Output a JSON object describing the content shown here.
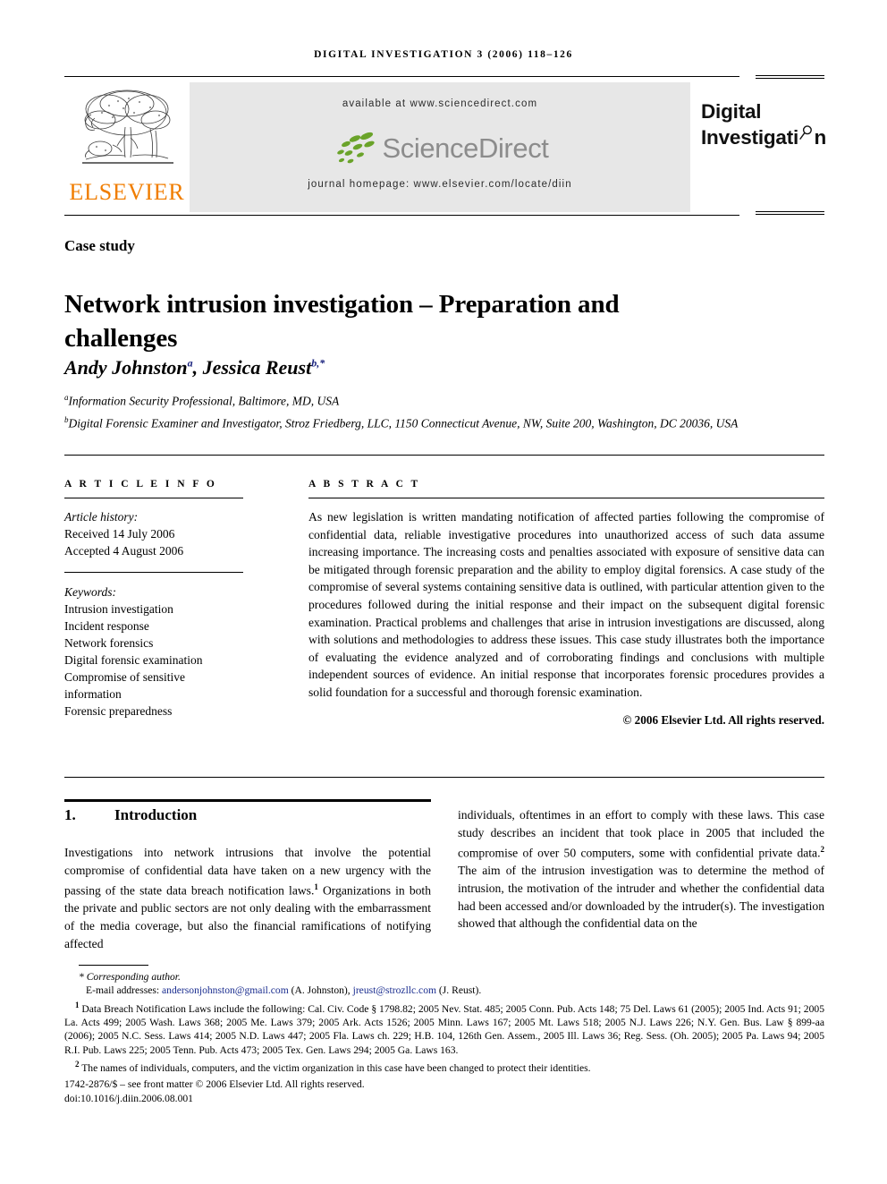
{
  "running_head": "DIGITAL INVESTIGATION 3 (2006) 118–126",
  "masthead": {
    "publisher_name": "ELSEVIER",
    "publisher_logo": "elsevier-tree-logo",
    "available_at": "available at www.sciencedirect.com",
    "sciencedirect_word": "ScienceDirect",
    "journal_homepage": "journal homepage: www.elsevier.com/locate/diin",
    "journal_logo_line1": "Digital",
    "journal_logo_line2a": "Investigati",
    "journal_logo_line2b": "n",
    "elsevier_orange": "#f07d00",
    "sciencedirect_green": "#6aa32a",
    "panel_gray": "#e7e7e7"
  },
  "article": {
    "kind": "Case study",
    "title": "Network intrusion investigation – Preparation and challenges",
    "authors_html": "Andy Johnston<sup>a</sup>, Jessica Reust<sup>b,*</sup>",
    "affiliations": [
      "<sup>a</sup>Information Security Professional, Baltimore, MD, USA",
      "<sup>b</sup>Digital Forensic Examiner and Investigator, Stroz Friedberg, LLC, 1150 Connecticut Avenue, NW, Suite 200, Washington, DC 20036, USA"
    ]
  },
  "article_info": {
    "heading": "A R T I C L E  I N F O",
    "history_label": "Article history:",
    "received": "Received 14 July 2006",
    "accepted": "Accepted 4 August 2006",
    "keywords_label": "Keywords:",
    "keywords": [
      "Intrusion investigation",
      "Incident response",
      "Network forensics",
      "Digital forensic examination",
      "Compromise of sensitive information",
      "Forensic preparedness"
    ]
  },
  "abstract": {
    "heading": "A B S T R A C T",
    "text": "As new legislation is written mandating notification of affected parties following the compromise of confidential data, reliable investigative procedures into unauthorized access of such data assume increasing importance. The increasing costs and penalties associated with exposure of sensitive data can be mitigated through forensic preparation and the ability to employ digital forensics. A case study of the compromise of several systems containing sensitive data is outlined, with particular attention given to the procedures followed during the initial response and their impact on the subsequent digital forensic examination. Practical problems and challenges that arise in intrusion investigations are discussed, along with solutions and methodologies to address these issues. This case study illustrates both the importance of evaluating the evidence analyzed and of corroborating findings and conclusions with multiple independent sources of evidence. An initial response that incorporates forensic procedures provides a solid foundation for a successful and thorough forensic examination.",
    "copyright": "© 2006 Elsevier Ltd. All rights reserved."
  },
  "introduction": {
    "number": "1.",
    "heading": "Introduction",
    "column_left": "Investigations into network intrusions that involve the potential compromise of confidential data have taken on a new urgency with the passing of the state data breach notification laws.<sup>1</sup> Organizations in both the private and public sectors are not only dealing with the embarrassment of the media coverage, but also the financial ramifications of notifying affected",
    "column_right": "individuals, oftentimes in an effort to comply with these laws. This case study describes an incident that took place in 2005 that included the compromise of over 50 computers, some with confidential private data.<sup>2</sup> The aim of the intrusion investigation was to determine the method of intrusion, the motivation of the intruder and whether the confidential data had been accessed and/or downloaded by the intruder(s). The investigation showed that although the confidential data on the"
  },
  "footnotes": {
    "corresponding_author": "* Corresponding author.",
    "email_prefix": "E-mail addresses:",
    "email_1": "andersonjohnston@gmail.com",
    "email_1_name": "(A. Johnston),",
    "email_2": "jreust@strozllc.com",
    "email_2_name": "(J. Reust).",
    "note_1": "<sup>1</sup> Data Breach Notification Laws include the following: Cal. Civ. Code § 1798.82; 2005 Nev. Stat. 485; 2005 Conn. Pub. Acts 148; 75 Del. Laws 61 (2005); 2005 Ind. Acts 91; 2005 La. Acts 499; 2005 Wash. Laws 368; 2005 Me. Laws 379; 2005 Ark. Acts 1526; 2005 Minn. Laws 167; 2005 Mt. Laws 518; 2005 N.J. Laws 226; N.Y. Gen. Bus. Law § 899-aa (2006); 2005 N.C. Sess. Laws 414; 2005 N.D. Laws 447; 2005 Fla. Laws ch. 229; H.B. 104, 126th Gen. Assem., 2005 Ill. Laws 36; Reg. Sess. (Oh. 2005); 2005 Pa. Laws 94; 2005 R.I. Pub. Laws 225; 2005 Tenn. Pub. Acts 473; 2005 Tex. Gen. Laws 294; 2005 Ga. Laws 163.",
    "note_2": "<sup>2</sup> The names of individuals, computers, and the victim organization in this case have been changed to protect their identities.",
    "issn_line": "1742-2876/$ – see front matter © 2006 Elsevier Ltd. All rights reserved.",
    "doi_line": "doi:10.1016/j.diin.2006.08.001"
  }
}
